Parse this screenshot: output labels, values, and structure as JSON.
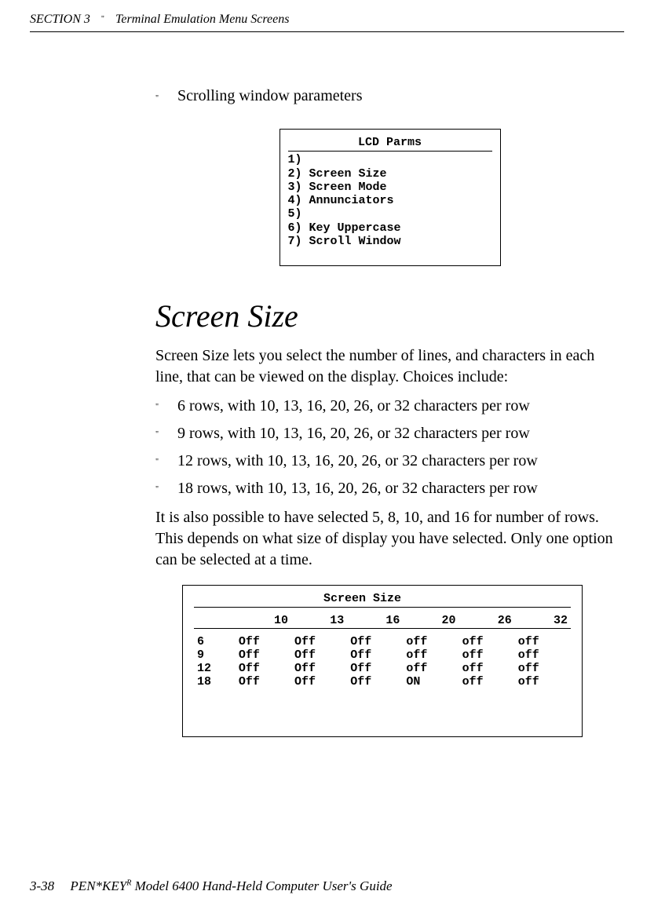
{
  "header": {
    "section_label": "SECTION 3",
    "bullet": "\"",
    "running_title": "Terminal Emulation Menu Screens"
  },
  "intro_bullet": {
    "marker": "\"",
    "text": "Scrolling window parameters"
  },
  "lcd_parms": {
    "title": "LCD Parms",
    "lines": [
      "1)",
      "2) Screen Size",
      "3) Screen Mode",
      "4) Annunciators",
      "5)",
      "6) Key Uppercase",
      "7) Scroll Window"
    ]
  },
  "section_title": "Screen Size",
  "para1": "Screen Size lets you select the number of lines, and characters in each line, that can be viewed on the display.  Choices include:",
  "options": [
    {
      "marker": "\"",
      "text": "6 rows, with 10, 13, 16, 20, 26, or 32 characters per row"
    },
    {
      "marker": "\"",
      "text": "9 rows, with 10, 13, 16, 20, 26, or 32 characters per row"
    },
    {
      "marker": "\"",
      "text": "12 rows, with 10, 13, 16, 20, 26, or 32 characters per row"
    },
    {
      "marker": "\"",
      "text": "18 rows, with 10, 13, 16, 20, 26, or 32 characters per row"
    }
  ],
  "para2": "It is also possible to have selected 5, 8, 10, and 16 for number of rows.  This depends on what size of display you have selected.  Only one option can be selected at a time.",
  "screen_size_box": {
    "title": "Screen Size",
    "cols": [
      "10",
      "13",
      "16",
      "20",
      "26",
      "32"
    ],
    "rows": [
      {
        "label": "6",
        "cells": [
          "Off",
          "Off",
          "Off",
          "off",
          "off",
          "off"
        ]
      },
      {
        "label": "9",
        "cells": [
          "Off",
          "Off",
          "Off",
          "off",
          "off",
          "off"
        ]
      },
      {
        "label": "12",
        "cells": [
          "Off",
          "Off",
          "Off",
          "off",
          "off",
          "off"
        ]
      },
      {
        "label": "18",
        "cells": [
          "Off",
          "Off",
          "Off",
          "ON",
          "off",
          "off"
        ]
      }
    ]
  },
  "footer": {
    "page": "3-38",
    "product_prefix": "PEN*KEY",
    "super": "R",
    "product_suffix": " Model 6400 Hand-Held Computer User's Guide"
  }
}
